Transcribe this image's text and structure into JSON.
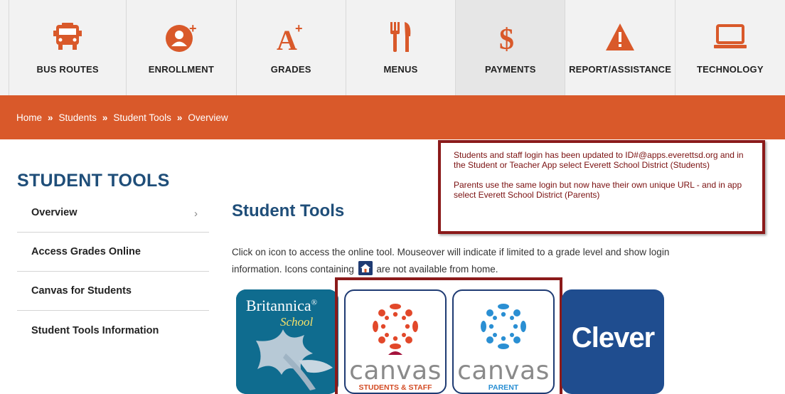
{
  "nav": {
    "items": [
      {
        "label": "BUS ROUTES",
        "icon": "bus-icon"
      },
      {
        "label": "ENROLLMENT",
        "icon": "add-user-icon"
      },
      {
        "label": "GRADES",
        "icon": "grade-a-plus-icon"
      },
      {
        "label": "MENUS",
        "icon": "fork-knife-icon"
      },
      {
        "label": "PAYMENTS",
        "icon": "dollar-icon"
      },
      {
        "label": "REPORT/ASSISTANCE",
        "icon": "warning-icon"
      },
      {
        "label": "TECHNOLOGY",
        "icon": "laptop-icon"
      }
    ],
    "accent_color": "#d9592a"
  },
  "breadcrumb": {
    "items": [
      "Home",
      "Students",
      "Student Tools",
      "Overview"
    ],
    "separator": "»"
  },
  "sidebar": {
    "title": "STUDENT TOOLS",
    "items": [
      {
        "label": "Overview"
      },
      {
        "label": "Access Grades Online"
      },
      {
        "label": "Canvas for Students"
      },
      {
        "label": "Student Tools Information"
      }
    ],
    "chevron": "›"
  },
  "main": {
    "title": "Student Tools",
    "desc_part1": "Click on icon to access the online tool. Mouseover will indicate if limited to a grade level and show login information. Icons containing",
    "desc_part2": "are not available from home."
  },
  "notice": {
    "para1": "Students and staff login has been updated to ID#@apps.everettsd.org and in the Student or Teacher App select Everett School District (Students)",
    "para2": "Parents use the same login but now have their own unique URL - and in app select Everett School District (Parents)"
  },
  "tiles": {
    "britannica": {
      "title": "Britannica",
      "reg": "®",
      "sub": "School"
    },
    "canvas_students": {
      "word": "canvas",
      "sub": "STUDENTS & STAFF"
    },
    "canvas_parent": {
      "word": "canvas",
      "sub": "PARENT"
    },
    "clever": {
      "word": "Clever"
    }
  }
}
